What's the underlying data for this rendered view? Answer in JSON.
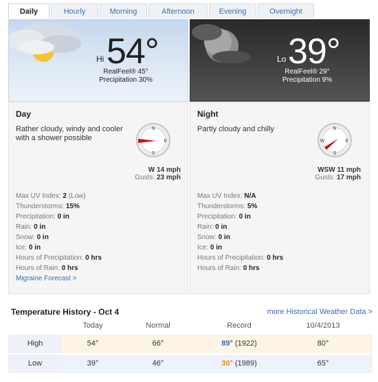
{
  "tabs": [
    {
      "label": "Daily",
      "active": true
    },
    {
      "label": "Hourly",
      "active": false
    },
    {
      "label": "Morning",
      "active": false
    },
    {
      "label": "Afternoon",
      "active": false
    },
    {
      "label": "Evening",
      "active": false
    },
    {
      "label": "Overnight",
      "active": false
    }
  ],
  "day": {
    "hilo": "Hi",
    "temp": "54°",
    "realfeel": "RealFeel® 45°",
    "precip": "Precipitation 30%",
    "title": "Day",
    "description": "Rather cloudy, windy and cooler with a shower possible",
    "wind": "W 14 mph",
    "gusts_label": "Gusts:",
    "gusts": "23 mph",
    "stats": [
      {
        "label": "Max UV Index:",
        "value": "2",
        "extra": "(Low)"
      },
      {
        "label": "Thunderstorms:",
        "value": "15%"
      },
      {
        "label": "Precipitation:",
        "value": "0 in"
      },
      {
        "label": "Rain:",
        "value": "0 in"
      },
      {
        "label": "Snow:",
        "value": "0 in"
      },
      {
        "label": "Ice:",
        "value": "0 in"
      },
      {
        "label": "Hours of Precipitation:",
        "value": "0 hrs"
      },
      {
        "label": "Hours of Rain:",
        "value": "0 hrs"
      }
    ],
    "link": "Migraine Forecast >"
  },
  "night": {
    "hilo": "Lo",
    "temp": "39°",
    "realfeel": "RealFeel® 29°",
    "precip": "Precipitation 9%",
    "title": "Night",
    "description": "Partly cloudy and chilly",
    "wind": "WSW 11 mph",
    "gusts_label": "Gusts:",
    "gusts": "17 mph",
    "stats": [
      {
        "label": "Max UV Index:",
        "value": "N/A"
      },
      {
        "label": "Thunderstorms:",
        "value": "5%"
      },
      {
        "label": "Precipitation:",
        "value": "0 in"
      },
      {
        "label": "Rain:",
        "value": "0 in"
      },
      {
        "label": "Snow:",
        "value": "0 in"
      },
      {
        "label": "Ice:",
        "value": "0 in"
      },
      {
        "label": "Hours of Precipitation:",
        "value": "0 hrs"
      },
      {
        "label": "Hours of Rain:",
        "value": "0 hrs"
      }
    ]
  },
  "compass": {
    "n": "N",
    "e": "E",
    "s": "S",
    "w": "W"
  },
  "history": {
    "title": "Temperature History - Oct 4",
    "more_link": "more Historical Weather Data >",
    "columns": [
      "Today",
      "Normal",
      "Record",
      "10/4/2013"
    ],
    "rows": [
      {
        "label": "High",
        "today": "54°",
        "normal": "66°",
        "record": "89°",
        "record_year": "(1922)",
        "last_year": "80°"
      },
      {
        "label": "Low",
        "today": "39°",
        "normal": "46°",
        "record": "30°",
        "record_year": "(1989)",
        "last_year": "65°"
      }
    ]
  },
  "colors": {
    "link": "#3a6eb0",
    "arrow": "#cc1111",
    "record_high": "#3a6eb0",
    "record_low": "#e79020"
  }
}
